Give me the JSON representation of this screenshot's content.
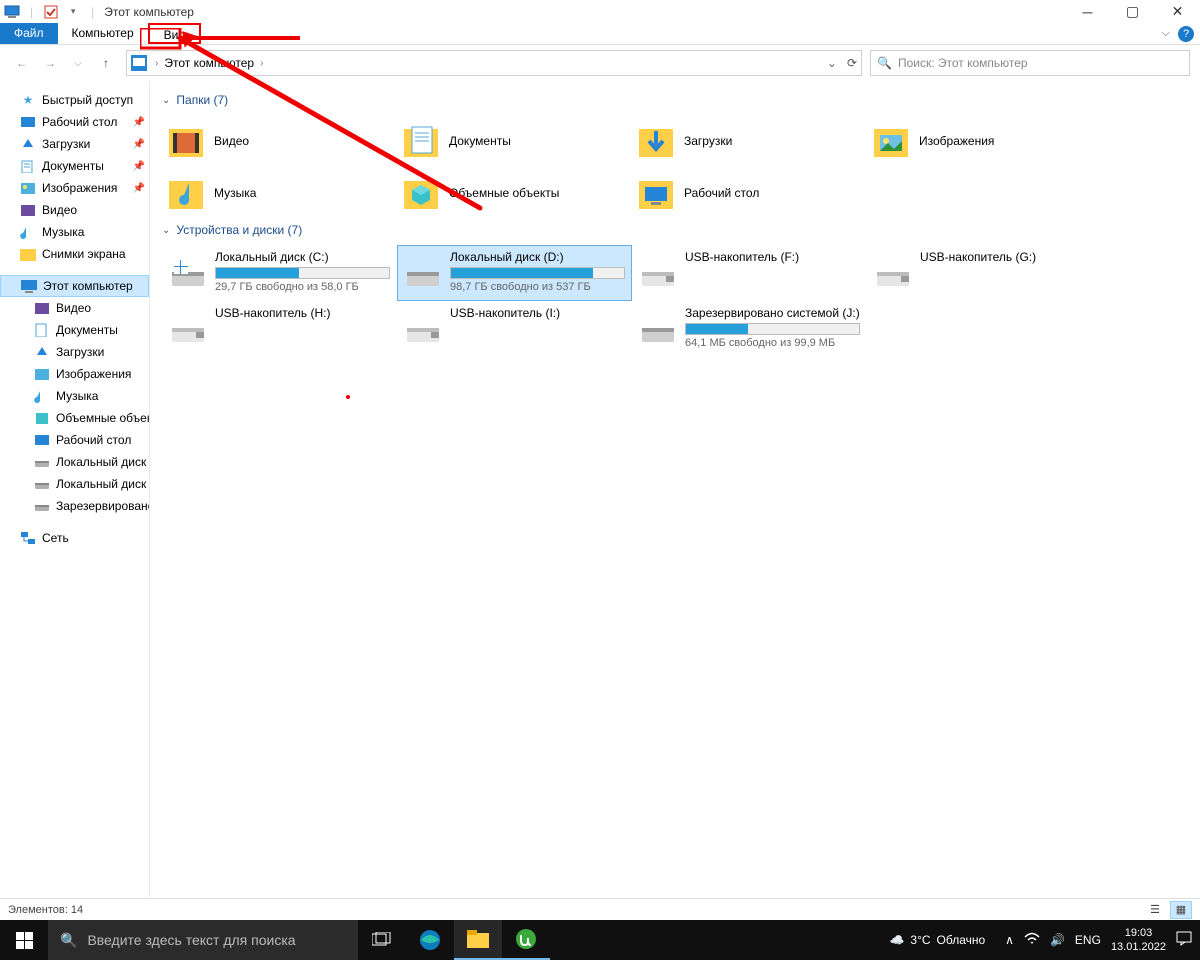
{
  "title": "Этот компьютер",
  "ribbon": {
    "file": "Файл",
    "computer": "Компьютер",
    "view": "Вид"
  },
  "nav": {
    "crumb": "Этот компьютер"
  },
  "search": {
    "placeholder": "Поиск: Этот компьютер"
  },
  "sidebar": {
    "quick": "Быстрый доступ",
    "quick_items": [
      {
        "label": "Рабочий стол",
        "pinned": true
      },
      {
        "label": "Загрузки",
        "pinned": true
      },
      {
        "label": "Документы",
        "pinned": true
      },
      {
        "label": "Изображения",
        "pinned": true
      },
      {
        "label": "Видео",
        "pinned": false
      },
      {
        "label": "Музыка",
        "pinned": false
      },
      {
        "label": "Снимки экрана",
        "pinned": false
      }
    ],
    "thispc": "Этот компьютер",
    "pc_items": [
      "Видео",
      "Документы",
      "Загрузки",
      "Изображения",
      "Музыка",
      "Объемные объекты",
      "Рабочий стол",
      "Локальный диск (C:)",
      "Локальный диск (D:)",
      "Зарезервировано системой"
    ],
    "network": "Сеть"
  },
  "groups": {
    "folders": {
      "title": "Папки",
      "count": "(7)"
    },
    "drives": {
      "title": "Устройства и диски",
      "count": "(7)"
    }
  },
  "folders": [
    {
      "label": "Видео"
    },
    {
      "label": "Документы"
    },
    {
      "label": "Загрузки"
    },
    {
      "label": "Изображения"
    },
    {
      "label": "Музыка"
    },
    {
      "label": "Объемные объекты"
    },
    {
      "label": "Рабочий стол"
    }
  ],
  "drives": [
    {
      "label": "Локальный диск (C:)",
      "sub": "29,7 ГБ свободно из 58,0 ГБ",
      "fill": 48,
      "sel": false,
      "kind": "os"
    },
    {
      "label": "Локальный диск (D:)",
      "sub": "98,7 ГБ свободно из 537 ГБ",
      "fill": 82,
      "sel": true,
      "kind": "hdd"
    },
    {
      "label": "USB-накопитель (F:)",
      "sub": "",
      "fill": -1,
      "sel": false,
      "kind": "usb"
    },
    {
      "label": "USB-накопитель (G:)",
      "sub": "",
      "fill": -1,
      "sel": false,
      "kind": "usb"
    },
    {
      "label": "USB-накопитель (H:)",
      "sub": "",
      "fill": -1,
      "sel": false,
      "kind": "usb"
    },
    {
      "label": "USB-накопитель (I:)",
      "sub": "",
      "fill": -1,
      "sel": false,
      "kind": "usb"
    },
    {
      "label": "Зарезервировано системой (J:)",
      "sub": "64,1 МБ свободно из 99,9 МБ",
      "fill": 36,
      "sel": false,
      "kind": "hdd"
    }
  ],
  "status": "Элементов: 14",
  "taskbar": {
    "search": "Введите здесь текст для поиска",
    "weather_temp": "3°C",
    "weather_cond": "Облачно",
    "lang": "ENG",
    "time": "19:03",
    "date": "13.01.2022"
  }
}
